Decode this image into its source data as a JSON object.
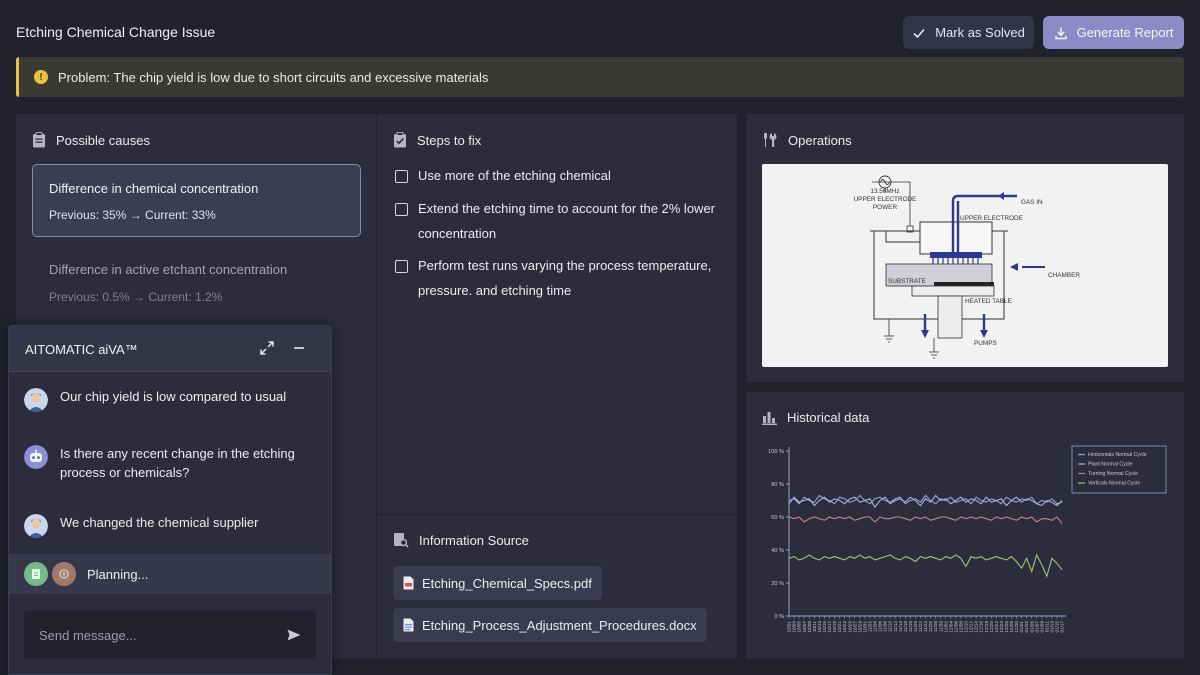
{
  "header": {
    "title": "Etching Chemical Change Issue",
    "mark_solved_label": "Mark as Solved",
    "generate_report_label": "Generate Report"
  },
  "alert": {
    "text": "Problem: The chip yield is low due to short circuits and excessive materials",
    "icon": "warning-icon"
  },
  "causes": {
    "title": "Possible causes",
    "items": [
      {
        "title": "Difference in chemical concentration",
        "values": "Previous: 35% → Current: 33%"
      },
      {
        "title": "Difference in active etchant concentration",
        "values": "Previous: 0.5% → Current: 1.2%"
      }
    ]
  },
  "steps": {
    "title": "Steps to fix",
    "items": [
      "Use more of the etching chemical",
      "Extend the etching time to account for the 2% lower concentration",
      "Perform test runs varying the process temperature, pressure. and etching time"
    ]
  },
  "info": {
    "title": "Information Source",
    "files": [
      "Etching_Chemical_Specs.pdf",
      "Etching_Process_Adjustment_Procedures.docx"
    ]
  },
  "operations": {
    "title": "Operations",
    "diagram": {
      "rf_label1": "13.56MHz",
      "rf_label2": "UPPER ELECTRODE",
      "rf_label3": "POWER",
      "gas_in": "GAS IN",
      "upper_electrode": "UPPER ELECTRODE",
      "chamber": "CHAMBER",
      "substrate": "SUBSTRATE",
      "heated_table": "HEATED TABLE",
      "pumps": "PUMPS"
    }
  },
  "historical": {
    "title": "Historical data"
  },
  "chart_data": {
    "type": "line",
    "ylim": [
      0,
      100
    ],
    "yticks": [
      "0 %",
      "20 %",
      "40 %",
      "60 %",
      "80 %",
      "100 %"
    ],
    "categories": [
      "10/01",
      "10/03",
      "10/05",
      "10/07",
      "10/09",
      "10/11",
      "10/13",
      "10/15",
      "10/17",
      "10/19",
      "10/21",
      "10/23",
      "10/25",
      "10/27",
      "10/29",
      "10/31",
      "11/02",
      "11/04",
      "11/06",
      "11/08",
      "11/10",
      "11/12",
      "11/14",
      "11/16",
      "11/18",
      "11/20",
      "11/22",
      "11/24",
      "11/26",
      "11/28",
      "11/30",
      "12/02",
      "12/04",
      "12/06",
      "12/08",
      "12/10",
      "12/12",
      "12/14",
      "12/16",
      "12/18",
      "12/20",
      "12/22",
      "12/24",
      "12/26",
      "12/28",
      "12/30",
      "01/01",
      "01/03",
      "01/05",
      "01/07",
      "01/09",
      "01/11",
      "01/13",
      "01/15",
      "01/17"
    ],
    "series": [
      {
        "name": "Horizontals Normal Cycle",
        "color": "#8fa3d8",
        "values": [
          70,
          71,
          68,
          72,
          70,
          69,
          73,
          71,
          70,
          68,
          72,
          71,
          69,
          70,
          73,
          70,
          68,
          71,
          72,
          70,
          69,
          71,
          72,
          68,
          70,
          71,
          69,
          73,
          70,
          68,
          71,
          70,
          72,
          69,
          70,
          71,
          68,
          72,
          70,
          69,
          71,
          70,
          68,
          72,
          70,
          69,
          71,
          70,
          72,
          68,
          70,
          69,
          71,
          68,
          69
        ]
      },
      {
        "name": "Plant Normal Cycle",
        "color": "#a3b3e6",
        "values": [
          68,
          72,
          69,
          70,
          71,
          67,
          70,
          72,
          69,
          71,
          70,
          68,
          71,
          72,
          69,
          70,
          71,
          66,
          70,
          72,
          68,
          70,
          71,
          69,
          72,
          70,
          67,
          71,
          69,
          73,
          70,
          71,
          68,
          70,
          72,
          69,
          71,
          70,
          68,
          72,
          69,
          70,
          71,
          67,
          70,
          72,
          69,
          71,
          70,
          68,
          67,
          70,
          69,
          67,
          70
        ]
      },
      {
        "name": "Turning Normal Cycle",
        "color": "#cf7f87",
        "values": [
          60,
          59,
          60,
          57,
          59,
          60,
          59,
          58,
          60,
          59,
          60,
          59,
          60,
          58,
          59,
          60,
          60,
          57,
          60,
          59,
          59,
          60,
          60,
          59,
          58,
          60,
          59,
          60,
          58,
          59,
          60,
          60,
          59,
          58,
          60,
          59,
          60,
          59,
          60,
          59,
          58,
          60,
          59,
          60,
          59,
          58,
          60,
          59,
          60,
          57,
          59,
          59,
          58,
          60,
          56
        ]
      },
      {
        "name": "Verticals Normal Cycle",
        "color": "#a6c378",
        "values": [
          35,
          36,
          34,
          35,
          37,
          35,
          34,
          36,
          35,
          36,
          35,
          34,
          36,
          35,
          37,
          35,
          36,
          34,
          35,
          36,
          37,
          35,
          34,
          36,
          35,
          33,
          36,
          35,
          36,
          35,
          34,
          36,
          35,
          37,
          35,
          30,
          36,
          35,
          36,
          34,
          35,
          36,
          35,
          34,
          36,
          33,
          29,
          35,
          27,
          37,
          31,
          24,
          35,
          32,
          28
        ]
      }
    ]
  },
  "chat": {
    "title": "AITOMATIC aiVA™",
    "messages": [
      {
        "role": "user",
        "text": "Our chip yield is low compared to usual"
      },
      {
        "role": "bot",
        "text": "Is there any recent change in the etching process or chemicals?"
      },
      {
        "role": "user",
        "text": "We changed the chemical supplier"
      }
    ],
    "status": "Planning...",
    "placeholder": "Send message..."
  }
}
